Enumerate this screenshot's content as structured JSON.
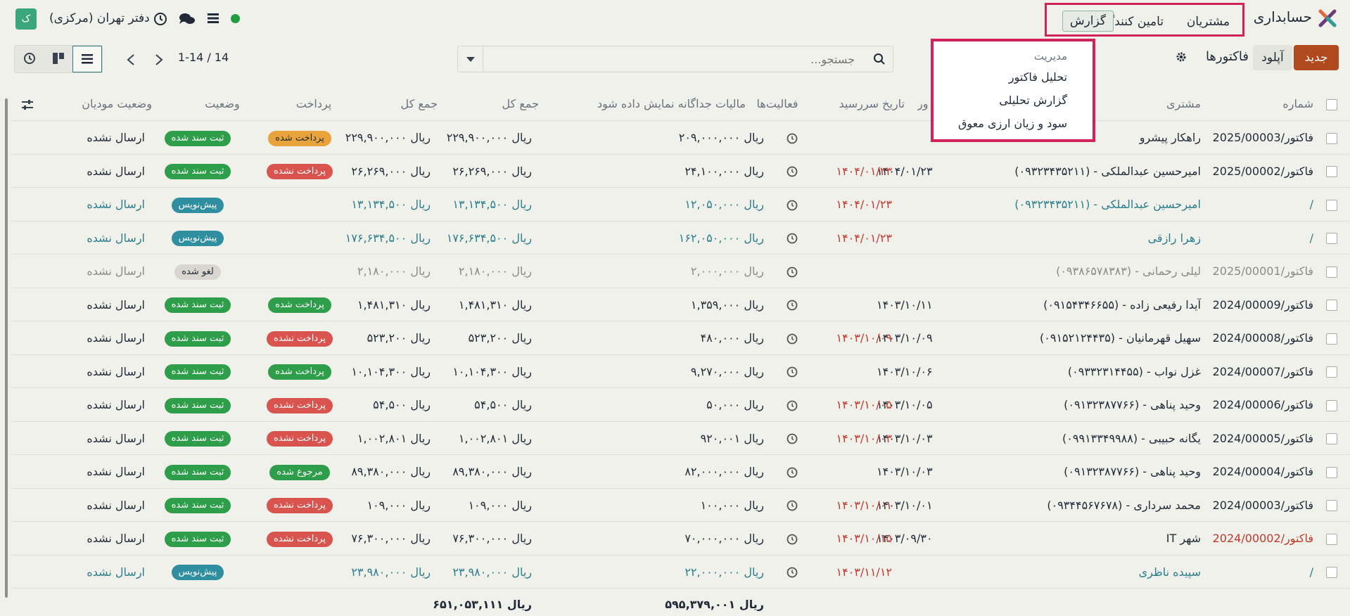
{
  "navbar": {
    "app_name": "حسابداری",
    "menu": {
      "customers": "مشتریان",
      "vendors": "تامین کنندگان",
      "report": "گزارش"
    },
    "company": "دفتر تهران (مرکزی)",
    "avatar": "ک"
  },
  "control": {
    "new_label": "جدید",
    "upload_label": "آپلود",
    "breadcrumb": "فاکتورها",
    "search_placeholder": "جستجو...",
    "pager": "1-14 / 14"
  },
  "dropdown": {
    "header": "مدیریت",
    "items": [
      "تحلیل فاکتور",
      "گزارش تحلیلی",
      "سود و زیان ارزی معوق"
    ]
  },
  "table": {
    "headers": {
      "number": "شماره",
      "customer": "مشتری",
      "invoice_date": "تاریخ فاکتور",
      "due_date": "تاریخ سررسید",
      "activities": "فعالیت‌ها",
      "tax": "مالیات جداگانه نمایش داده شود",
      "total1": "جمع کل",
      "total2": "جمع کل",
      "payment": "پرداخت",
      "state": "وضعیت",
      "send_state": "وضعیت مودیان"
    },
    "rows": [
      {
        "number": "فاکتور/2025/00003",
        "customer": "راهکار پیشرو",
        "inv_date": "",
        "due": "",
        "tax": "ریال ۲۰۹,۰۰۰,۰۰۰",
        "total1": "ریال ۲۲۹,۹۰۰,۰۰۰",
        "total2": "ریال ۲۲۹,۹۰۰,۰۰۰",
        "payment": "پرداخت شده",
        "pay_color": "orange",
        "state": "ثبت سند شده",
        "state_color": "green",
        "send": "ارسال نشده",
        "kind": "normal"
      },
      {
        "number": "فاکتور/2025/00002",
        "customer": "امیرحسین عبدالملکی - (۰۹۳۲۳۴۳۵۲۱۱)",
        "inv_date": "۱۴۰۴/۰۱/۲۳",
        "due": "۱۴۰۴/۰۱/۲۳",
        "tax": "ریال ۲۴,۱۰۰,۰۰۰",
        "total1": "ریال ۲۶,۲۶۹,۰۰۰",
        "total2": "ریال ۲۶,۲۶۹,۰۰۰",
        "payment": "پرداخت نشده",
        "pay_color": "red",
        "state": "ثبت سند شده",
        "state_color": "green",
        "send": "ارسال نشده",
        "kind": "normal"
      },
      {
        "number": "/",
        "customer": "امیرحسین عبدالملکی - (۰۹۳۲۳۴۳۵۲۱۱)",
        "inv_date": "",
        "due": "۱۴۰۴/۰۱/۲۳",
        "tax": "ریال ۱۲,۰۵۰,۰۰۰",
        "total1": "ریال ۱۳,۱۳۴,۵۰۰",
        "total2": "ریال ۱۳,۱۳۴,۵۰۰",
        "payment": "",
        "pay_color": "",
        "state": "پیش‌نویس",
        "state_color": "teal",
        "send": "ارسال نشده",
        "kind": "draft"
      },
      {
        "number": "/",
        "customer": "زهرا رازقی",
        "inv_date": "",
        "due": "۱۴۰۴/۰۱/۲۳",
        "tax": "ریال ۱۶۲,۰۵۰,۰۰۰",
        "total1": "ریال ۱۷۶,۶۳۴,۵۰۰",
        "total2": "ریال ۱۷۶,۶۳۴,۵۰۰",
        "payment": "",
        "pay_color": "",
        "state": "پیش‌نویس",
        "state_color": "teal",
        "send": "ارسال نشده",
        "kind": "draft"
      },
      {
        "number": "فاکتور/2025/00001",
        "customer": "لیلی رحمانی - (۰۹۳۸۶۵۷۸۳۸۳)",
        "inv_date": "",
        "due": "",
        "tax": "ریال ۲,۰۰۰,۰۰۰",
        "total1": "ریال ۲,۱۸۰,۰۰۰",
        "total2": "ریال ۲,۱۸۰,۰۰۰",
        "payment": "",
        "pay_color": "",
        "state": "لغو شده",
        "state_color": "grey",
        "send": "ارسال نشده",
        "kind": "cancel"
      },
      {
        "number": "فاکتور/2024/00009",
        "customer": "آیدا رفیعی زاده - (۰۹۱۵۴۳۴۶۶۵۵)",
        "inv_date": "۱۴۰۳/۱۰/۱۱",
        "due": "",
        "tax": "ریال ۱,۳۵۹,۰۰۰",
        "total1": "ریال ۱,۴۸۱,۳۱۰",
        "total2": "ریال ۱,۴۸۱,۳۱۰",
        "payment": "پرداخت شده",
        "pay_color": "green",
        "state": "ثبت سند شده",
        "state_color": "green",
        "send": "ارسال نشده",
        "kind": "normal"
      },
      {
        "number": "فاکتور/2024/00008",
        "customer": "سهیل قهرمانیان - (۰۹۱۵۲۱۲۴۴۳۵)",
        "inv_date": "۱۴۰۳/۱۰/۰۹",
        "due": "۱۴۰۳/۱۰/۰۹",
        "tax": "ریال ۴۸۰,۰۰۰",
        "total1": "ریال ۵۲۳,۲۰۰",
        "total2": "ریال ۵۲۳,۲۰۰",
        "payment": "پرداخت نشده",
        "pay_color": "red",
        "state": "ثبت سند شده",
        "state_color": "green",
        "send": "ارسال نشده",
        "kind": "normal"
      },
      {
        "number": "فاکتور/2024/00007",
        "customer": "غزل نواب - (۰۹۳۳۲۳۱۴۴۵۵)",
        "inv_date": "۱۴۰۳/۱۰/۰۶",
        "due": "",
        "tax": "ریال ۹,۲۷۰,۰۰۰",
        "total1": "ریال ۱۰,۱۰۴,۳۰۰",
        "total2": "ریال ۱۰,۱۰۴,۳۰۰",
        "payment": "پرداخت شده",
        "pay_color": "green",
        "state": "ثبت سند شده",
        "state_color": "green",
        "send": "ارسال نشده",
        "kind": "normal"
      },
      {
        "number": "فاکتور/2024/00006",
        "customer": "وحید پناهی - (۰۹۱۳۲۳۸۷۷۶۶)",
        "inv_date": "۱۴۰۳/۱۰/۰۵",
        "due": "۱۴۰۳/۱۰/۰۵",
        "tax": "ریال ۵۰,۰۰۰",
        "total1": "ریال ۵۴,۵۰۰",
        "total2": "ریال ۵۴,۵۰۰",
        "payment": "پرداخت نشده",
        "pay_color": "red",
        "state": "ثبت سند شده",
        "state_color": "green",
        "send": "ارسال نشده",
        "kind": "normal"
      },
      {
        "number": "فاکتور/2024/00005",
        "customer": "یگانه حبیبی - (۰۹۹۱۳۳۴۹۹۸۸)",
        "inv_date": "۱۴۰۳/۱۰/۰۳",
        "due": "۱۴۰۳/۱۰/۰۳",
        "tax": "ریال ۹۲۰,۰۰۱",
        "total1": "ریال ۱,۰۰۲,۸۰۱",
        "total2": "ریال ۱,۰۰۲,۸۰۱",
        "payment": "پرداخت نشده",
        "pay_color": "red",
        "state": "ثبت سند شده",
        "state_color": "green",
        "send": "ارسال نشده",
        "kind": "normal"
      },
      {
        "number": "فاکتور/2024/00004",
        "customer": "وحید پناهی - (۰۹۱۳۲۳۸۷۷۶۶)",
        "inv_date": "۱۴۰۳/۱۰/۰۳",
        "due": "",
        "tax": "ریال ۸۲,۰۰۰,۰۰۰",
        "total1": "ریال ۸۹,۳۸۰,۰۰۰",
        "total2": "ریال ۸۹,۳۸۰,۰۰۰",
        "payment": "مرجوع شده",
        "pay_color": "green",
        "state": "ثبت سند شده",
        "state_color": "green",
        "send": "ارسال نشده",
        "kind": "normal"
      },
      {
        "number": "فاکتور/2024/00003",
        "customer": "محمد سرداری - (۰۹۳۴۴۵۶۷۶۷۸)",
        "inv_date": "۱۴۰۳/۱۰/۰۱",
        "due": "۱۴۰۳/۱۰/۰۱",
        "tax": "ریال ۱۰۰,۰۰۰",
        "total1": "ریال ۱۰۹,۰۰۰",
        "total2": "ریال ۱۰۹,۰۰۰",
        "payment": "پرداخت نشده",
        "pay_color": "red",
        "state": "ثبت سند شده",
        "state_color": "green",
        "send": "ارسال نشده",
        "kind": "normal"
      },
      {
        "number": "فاکتور/2024/00002",
        "customer": "شهر IT",
        "inv_date": "۱۴۰۳/۰۹/۳۰",
        "due": "۱۴۰۳/۱۰/۱۵",
        "tax": "ریال ۷۰,۰۰۰,۰۰۰",
        "total1": "ریال ۷۶,۳۰۰,۰۰۰",
        "total2": "ریال ۷۶,۳۰۰,۰۰۰",
        "payment": "پرداخت نشده",
        "pay_color": "red",
        "state": "ثبت سند شده",
        "state_color": "green",
        "send": "ارسال نشده",
        "kind": "overdue-number"
      },
      {
        "number": "/",
        "customer": "سپیده ناظری",
        "inv_date": "",
        "due": "۱۴۰۳/۱۱/۱۲",
        "tax": "ریال ۲۲,۰۰۰,۰۰۰",
        "total1": "ریال ۲۳,۹۸۰,۰۰۰",
        "total2": "ریال ۲۳,۹۸۰,۰۰۰",
        "payment": "",
        "pay_color": "",
        "state": "پیش‌نویس",
        "state_color": "teal",
        "send": "ارسال نشده",
        "kind": "draft"
      }
    ],
    "footer": {
      "tax_sum": "ریال ۵۹۵,۳۷۹,۰۰۱",
      "total_sum": "ریال ۶۵۱,۰۵۳,۱۱۱"
    }
  }
}
